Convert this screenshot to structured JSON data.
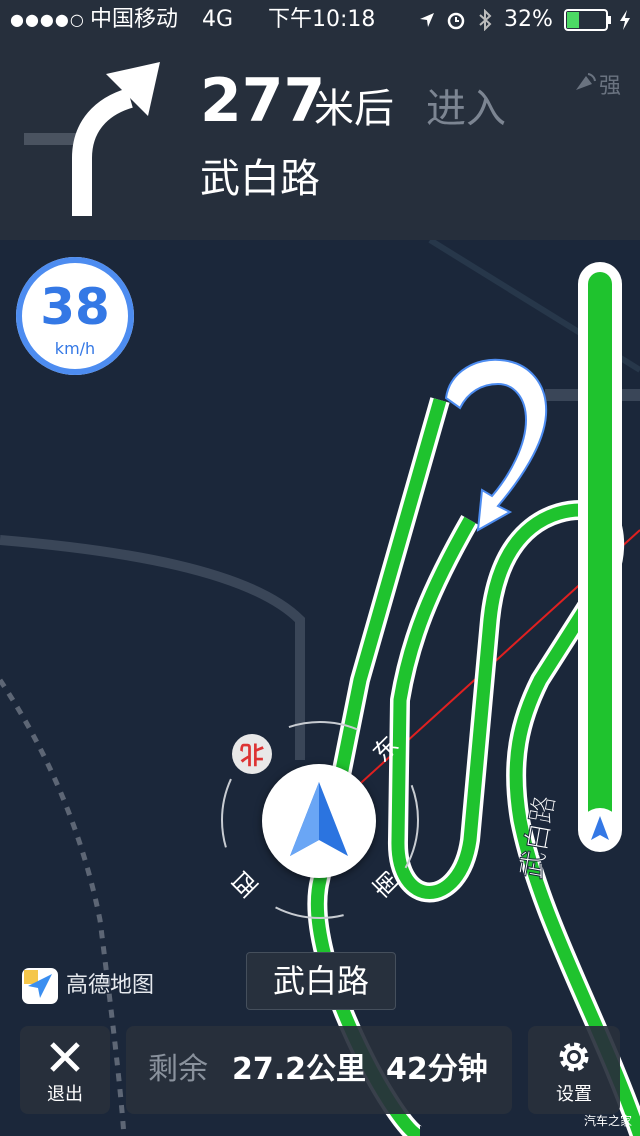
{
  "status_bar": {
    "signal_dots": "●●●●○",
    "carrier": "中国移动",
    "network": "4G",
    "time": "下午10:18",
    "battery_percent": "32%",
    "battery_level": 0.32,
    "icons": [
      "location-arrow-icon",
      "alarm-icon",
      "bluetooth-icon",
      "battery-icon",
      "charging-bolt-icon"
    ]
  },
  "guidance": {
    "distance_value": "277",
    "distance_unit": "米后",
    "action": "进入",
    "road": "武白路",
    "signal_label": "强",
    "turn_icon": "turn-right-arrow-icon",
    "signal_icon": "gps-signal-icon"
  },
  "speed": {
    "value": "38",
    "unit": "km/h"
  },
  "compass": {
    "north": "北",
    "east": "东",
    "south": "南",
    "west": "西"
  },
  "map": {
    "road_label": "武白路",
    "logo_text": "高德地图",
    "watermark": "汽车之家"
  },
  "current_road": "武白路",
  "bottom_bar": {
    "exit_label": "退出",
    "remaining_label": "剩余",
    "remaining_distance": "27.2公里",
    "remaining_time": "42分钟",
    "settings_label": "设置"
  },
  "colors": {
    "route": "#1fc32e",
    "accent": "#3478e5",
    "background": "#1b273a",
    "header": "#262f3c"
  }
}
